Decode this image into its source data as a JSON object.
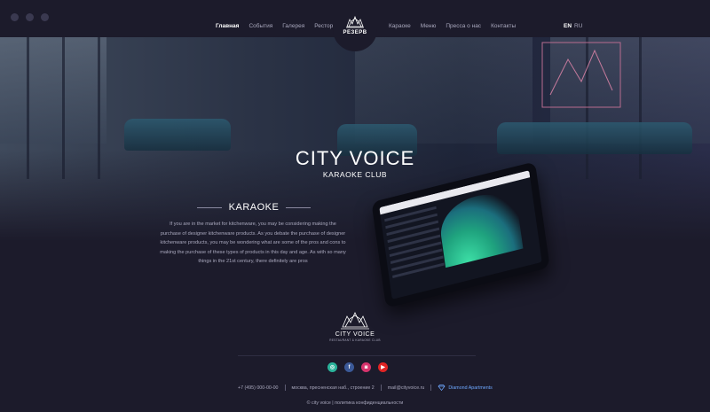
{
  "nav_left": [
    "Главная",
    "События",
    "Галерея",
    "Ресторан"
  ],
  "nav_right": [
    "Караоке",
    "Меню",
    "Пресса о нас",
    "Контакты"
  ],
  "lang": {
    "en": "EN",
    "ru": "RU"
  },
  "logo_tab": {
    "label": "РЕЗЕРВ"
  },
  "hero": {
    "title": "CITY VOICE",
    "subtitle": "KARAOKE CLUB"
  },
  "section": {
    "title": "KARAOKE",
    "text": "If you are in the market for kitchenware, you may be considering making the purchase of designer kitchenware products. As you debate the purchase of designer kitchenware products, you may be wondering what are some of the pros and cons to making the purchase of these types of products in this day and age. As with so many things in the 21st century, there definitely are pros"
  },
  "footer": {
    "logo_name": "CITY VOICE",
    "logo_tagline": "RESTAURANT & KARAOKE CLUB",
    "phone": "+7 (495) 000-00-00",
    "address": "москва, пресненская наб., строение 2",
    "email": "mail@cityvoice.ru",
    "partner": "Diamond Apartments",
    "copyright": "© city voice | политика конфиденциальности"
  },
  "socials": [
    {
      "name": "tripadvisor-icon",
      "color": "#2bb39b",
      "glyph": "◎"
    },
    {
      "name": "facebook-icon",
      "color": "#3b5998",
      "glyph": "f"
    },
    {
      "name": "instagram-icon",
      "color": "#d6336c",
      "glyph": "◙"
    },
    {
      "name": "youtube-icon",
      "color": "#e02424",
      "glyph": "▶"
    }
  ]
}
